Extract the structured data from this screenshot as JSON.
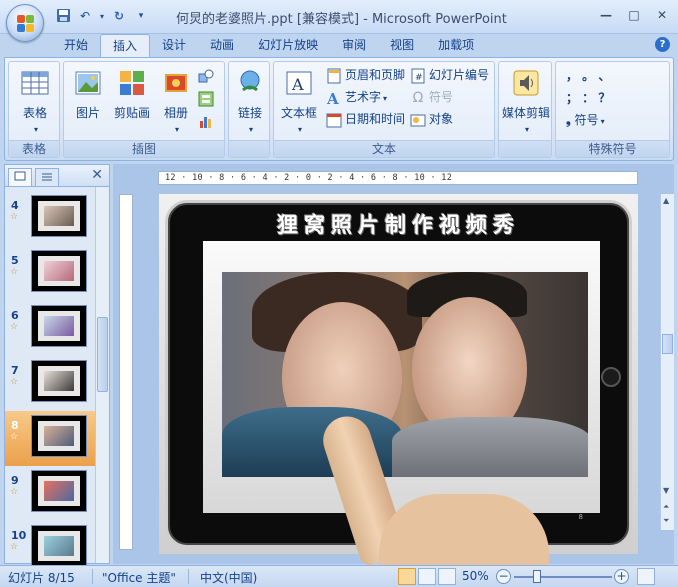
{
  "window": {
    "title": "何炅的老婆照片.ppt [兼容模式] - Microsoft PowerPoint"
  },
  "quick_access": {
    "save_icon": "save-icon",
    "undo_icon": "undo-icon",
    "redo_icon": "redo-icon",
    "customize_icon": "customize-icon"
  },
  "window_controls": {
    "minimize": "—",
    "maximize": "□",
    "close": "✕"
  },
  "tabs": [
    {
      "label": "开始"
    },
    {
      "label": "插入",
      "active": true
    },
    {
      "label": "设计"
    },
    {
      "label": "动画"
    },
    {
      "label": "幻灯片放映"
    },
    {
      "label": "审阅"
    },
    {
      "label": "视图"
    },
    {
      "label": "加载项"
    }
  ],
  "help_label": "?",
  "ribbon": {
    "groups": {
      "tables": {
        "label": "表格",
        "table_button": "表格"
      },
      "illustrations": {
        "label": "插图",
        "picture": "图片",
        "clipart": "剪贴画",
        "album": "相册"
      },
      "links": {
        "label": "",
        "link": "链接"
      },
      "text": {
        "label": "文本",
        "textbox": "文本框",
        "header_footer": "页眉和页脚",
        "wordart": "艺术字",
        "datetime": "日期和时间",
        "slide_number": "幻灯片编号",
        "symbol": "符号",
        "object": "对象"
      },
      "media": {
        "label": "",
        "media_clip": "媒体剪辑"
      },
      "special_symbols": {
        "label": "特殊符号",
        "symbols_row1": "，   。   、",
        "symbols_row2": "；   ：   ？",
        "symbol_button": "符号"
      }
    }
  },
  "slide_panel": {
    "slides": [
      {
        "number": "4"
      },
      {
        "number": "5"
      },
      {
        "number": "6"
      },
      {
        "number": "7"
      },
      {
        "number": "8",
        "selected": true
      },
      {
        "number": "9"
      },
      {
        "number": "10"
      }
    ]
  },
  "ruler": {
    "horizontal_marks": "12 · 10 · 8 · 6 · 4 · 2 · 0 · 2 · 4 · 6 · 8 · 10 · 12"
  },
  "slide": {
    "heading": "狸窝照片制作视频秀",
    "page_number": "8"
  },
  "status_bar": {
    "slide_indicator": "幻灯片 8/15",
    "theme": "\"Office 主题\"",
    "language": "中文(中国)",
    "zoom": "50%"
  },
  "colors": {
    "ribbon_accent": "#15428b",
    "selected_slide": "#eba04a"
  }
}
